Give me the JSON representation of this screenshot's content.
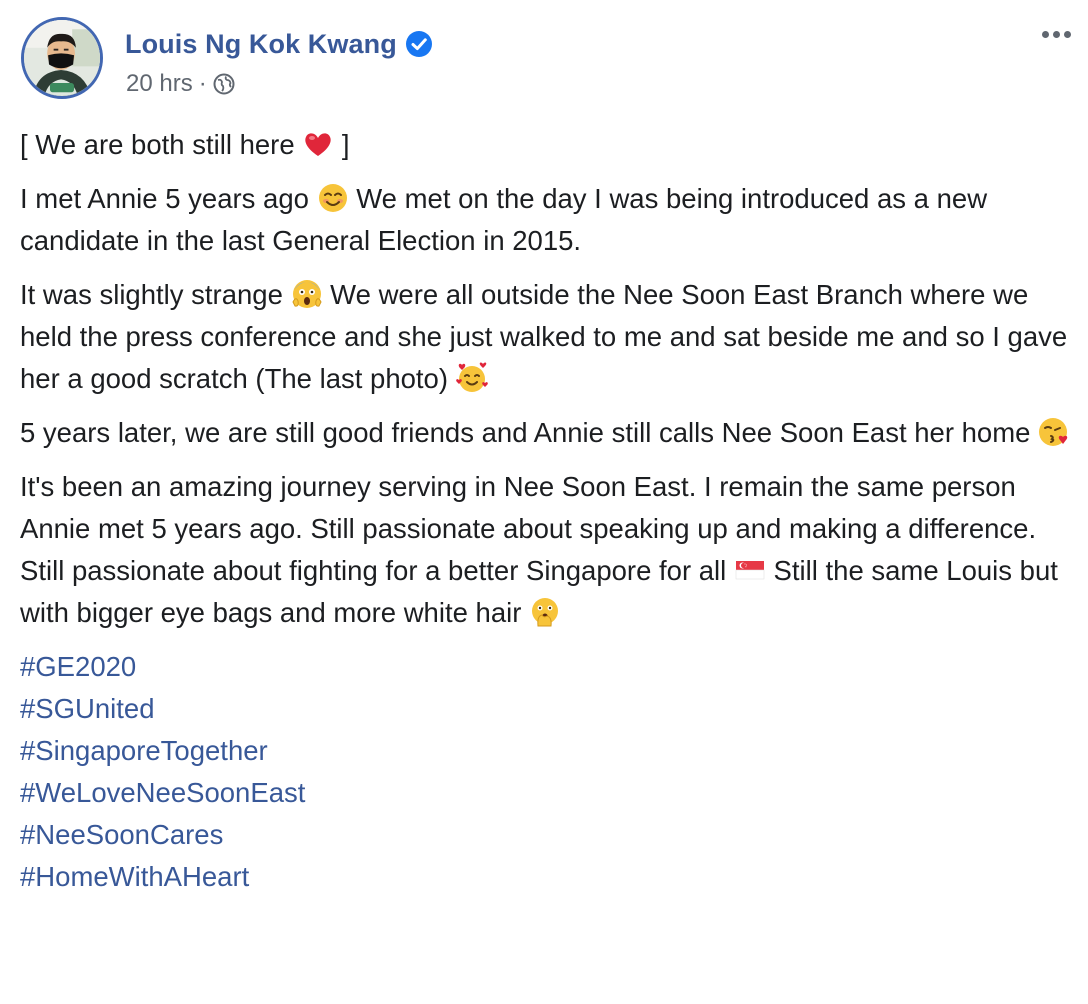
{
  "post": {
    "author": {
      "name": "Louis Ng Kok Kwang",
      "verified": true,
      "avatar_icon": "profile-photo-masked-man"
    },
    "meta": {
      "time": "20 hrs",
      "separator": "·",
      "audience_icon": "globe-icon"
    },
    "menu_icon": "more-options-icon",
    "paragraphs": {
      "p1": {
        "a": "[ We are both still here ",
        "emoji": "red-heart",
        "b": " ]"
      },
      "p2": {
        "a": "I met Annie 5 years ago ",
        "emoji": "smiling-face",
        "b": " We met on the day I was being introduced as a new candidate in the last General Election in 2015."
      },
      "p3": {
        "a": "It was slightly strange ",
        "emoji": "screaming-face",
        "b": " We were all outside the Nee Soon East Branch where we held the press conference and she just walked to me and sat beside me and so I gave her a good scratch (The last photo) ",
        "emoji2": "smiling-face-with-hearts"
      },
      "p4": {
        "a": "5 years later, we are still good friends and Annie still calls Nee Soon East her home ",
        "emoji": "face-blowing-kiss"
      },
      "p5": {
        "a": "It's been an amazing journey serving in Nee Soon East. I remain the same person Annie met 5 years ago. Still passionate about speaking up and making a difference. Still passionate about fighting for a better Singapore for all ",
        "emoji": "singapore-flag",
        "b": " Still the same Louis but with bigger eye bags and more white hair ",
        "emoji2": "face-with-open-eyes-and-hand-over-mouth"
      }
    },
    "hashtags": [
      "#GE2020",
      "#SGUnited",
      "#SingaporeTogether",
      "#WeLoveNeeSoonEast",
      "#NeeSoonCares",
      "#HomeWithAHeart"
    ],
    "colors": {
      "link": "#385898",
      "text": "#1c1e21",
      "secondary": "#606770",
      "verified": "#1877f2",
      "avatar_ring": "#4267b2"
    }
  }
}
